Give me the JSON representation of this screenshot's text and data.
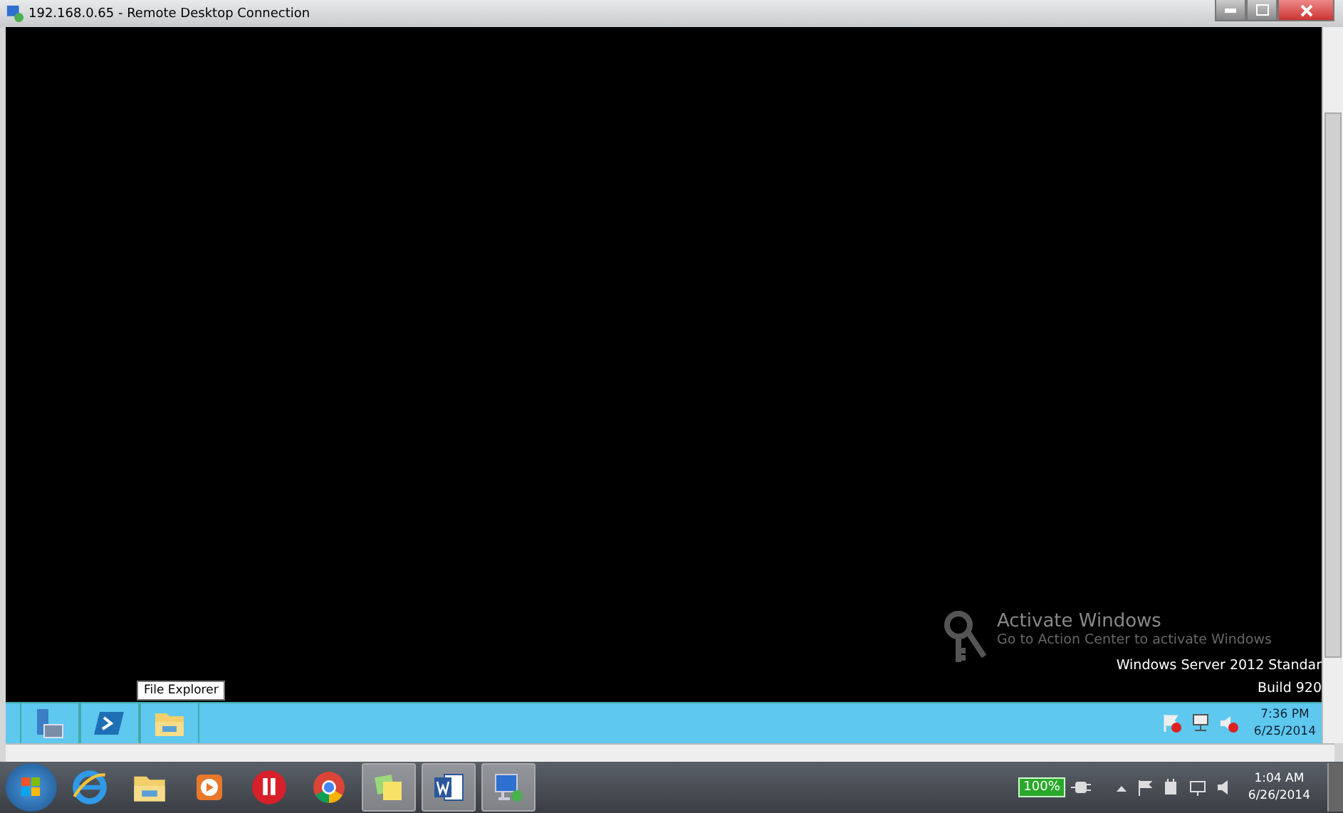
{
  "window": {
    "title": "192.168.0.65 - Remote Desktop Connection"
  },
  "remote": {
    "activation": {
      "title": "Activate Windows",
      "message": "Go to Action Center to activate Windows"
    },
    "edition": [
      "Windows Server 2012 Standar",
      "Build 920"
    ],
    "tooltip": "File Explorer",
    "pinned": [
      {
        "kind": "server-manager"
      },
      {
        "kind": "powershell"
      },
      {
        "kind": "explorer"
      }
    ],
    "tray": [
      {
        "kind": "flag"
      },
      {
        "kind": "network"
      },
      {
        "kind": "volume"
      }
    ],
    "clock": {
      "time": "7:36 PM",
      "date": "6/25/2014"
    }
  },
  "host_taskbar": {
    "apps": [
      {
        "kind": "ie",
        "running": false
      },
      {
        "kind": "explorer",
        "running": false
      },
      {
        "kind": "media",
        "running": false
      },
      {
        "kind": "red-app",
        "running": false
      },
      {
        "kind": "chrome",
        "running": false
      },
      {
        "kind": "notes",
        "running": true
      },
      {
        "kind": "word",
        "running": true
      },
      {
        "kind": "rdp",
        "running": true
      }
    ],
    "battery": "100%",
    "clock": {
      "time": "1:04 AM",
      "date": "6/26/2014"
    }
  }
}
